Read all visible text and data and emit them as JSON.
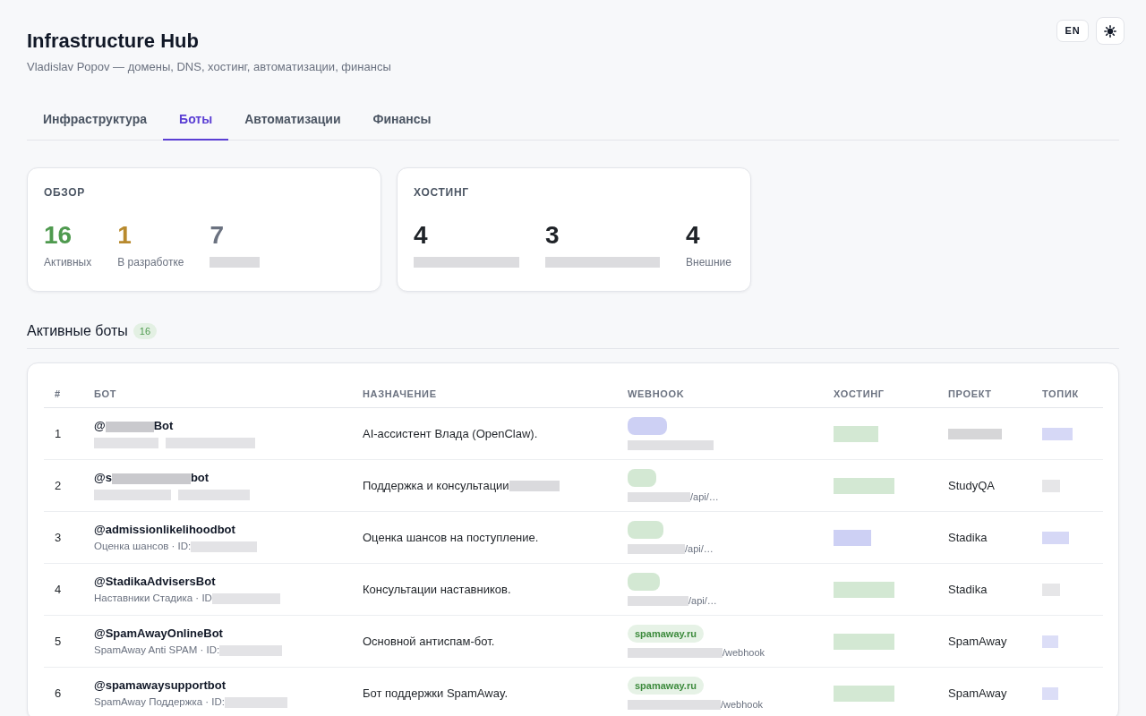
{
  "header": {
    "title": "Infrastructure Hub",
    "subtitle": "Vladislav Popov — домены, DNS, хостинг, автоматизации, финансы",
    "language_button": "EN"
  },
  "tabs": [
    {
      "label": "Инфраструктура",
      "selected": false
    },
    {
      "label": "Боты",
      "selected": true
    },
    {
      "label": "Автоматизации",
      "selected": false
    },
    {
      "label": "Финансы",
      "selected": false
    }
  ],
  "summary_cards": [
    {
      "title": "ОБЗОР",
      "stats": [
        {
          "value": "16",
          "color": "#4f9a4f",
          "label": [
            {
              "kind": "text",
              "text": "Активных"
            }
          ]
        },
        {
          "value": "1",
          "color": "#b88a2e",
          "label": [
            {
              "kind": "text",
              "text": "В разработке"
            }
          ]
        },
        {
          "value": "7",
          "color": "#6b7280",
          "label": [
            {
              "kind": "blur",
              "color": "#dcdcdf"
            }
          ]
        }
      ]
    },
    {
      "title": "ХОСТИНГ",
      "stats": [
        {
          "value": "4",
          "color": "#1f2328",
          "label": [
            {
              "kind": "blur",
              "color": "#dcdcdf"
            }
          ]
        },
        {
          "value": "3",
          "color": "#1f2328",
          "label": [
            {
              "kind": "blur",
              "color": "#dcdcdf"
            }
          ]
        },
        {
          "value": "4",
          "color": "#1f2328",
          "label": [
            {
              "kind": "text",
              "text": "Внешние"
            }
          ]
        }
      ]
    }
  ],
  "section": {
    "title": "Активные боты",
    "count": "16"
  },
  "table": {
    "columns": [
      "#",
      "БОТ",
      "НАЗНАЧЕНИЕ",
      "WEBHOOK",
      "ХОСТИНГ",
      "ПРОЕКТ",
      "ТОПИК"
    ],
    "rows": [
      {
        "number": "1",
        "handle": [
          {
            "kind": "text",
            "text": "@"
          },
          {
            "kind": "blur",
            "color": "#c9c9cd"
          },
          {
            "kind": "text",
            "text": "Bot"
          }
        ],
        "details": [
          {
            "kind": "blur",
            "color": "#e3e3e6"
          },
          {
            "kind": "blur",
            "color": "#e3e3e6"
          }
        ],
        "purpose": [
          {
            "kind": "text",
            "text": "AI-ассистент Влада (OpenClaw)."
          }
        ],
        "webhook_badge": [
          {
            "kind": "blur",
            "color": "#cdd0f4"
          }
        ],
        "webhook_url": [
          {
            "kind": "blur",
            "color": "#e0e0e3"
          }
        ],
        "hosting": [
          {
            "kind": "blur",
            "color": "#d3e8d3"
          }
        ],
        "project": [
          {
            "kind": "blur",
            "color": "#d6d6d8"
          }
        ],
        "topic": [
          {
            "kind": "blur",
            "color": "#d6d8f6"
          }
        ]
      },
      {
        "number": "2",
        "handle": [
          {
            "kind": "text",
            "text": "@s"
          },
          {
            "kind": "blur",
            "color": "#c9c9cd"
          },
          {
            "kind": "text",
            "text": "bot"
          }
        ],
        "details": [
          {
            "kind": "blur",
            "color": "#e3e3e6"
          },
          {
            "kind": "blur",
            "color": "#e3e3e6"
          }
        ],
        "purpose": [
          {
            "kind": "text",
            "text": "Поддержка и консультации"
          },
          {
            "kind": "blur",
            "color": "#dadadd"
          }
        ],
        "webhook_badge": [
          {
            "kind": "blur",
            "color": "#d3e8d3"
          }
        ],
        "webhook_url": [
          {
            "kind": "blur",
            "color": "#e0e0e3"
          },
          {
            "kind": "text",
            "text": "/api/…"
          }
        ],
        "hosting": [
          {
            "kind": "blur",
            "color": "#d3e8d3"
          }
        ],
        "project": [
          {
            "kind": "text",
            "text": "StudyQA"
          }
        ],
        "topic": [
          {
            "kind": "blur",
            "color": "#e6e6e8"
          }
        ]
      },
      {
        "number": "3",
        "handle": [
          {
            "kind": "text",
            "text": "@admissionlikelihoodbot"
          }
        ],
        "details": [
          {
            "kind": "text",
            "text": "Оценка шансов · ID:"
          },
          {
            "kind": "blur",
            "color": "#e3e3e6"
          }
        ],
        "purpose": [
          {
            "kind": "text",
            "text": "Оценка шансов на поступление."
          }
        ],
        "webhook_badge": [
          {
            "kind": "blur",
            "color": "#d3e8d3"
          }
        ],
        "webhook_url": [
          {
            "kind": "blur",
            "color": "#e0e0e3"
          },
          {
            "kind": "text",
            "text": "/api/…"
          }
        ],
        "hosting": [
          {
            "kind": "blur",
            "color": "#cdd0f4"
          }
        ],
        "project": [
          {
            "kind": "text",
            "text": "Stadika"
          }
        ],
        "topic": [
          {
            "kind": "blur",
            "color": "#d6d8f6"
          }
        ]
      },
      {
        "number": "4",
        "handle": [
          {
            "kind": "text",
            "text": "@StadikaAdvisersBot"
          }
        ],
        "details": [
          {
            "kind": "text",
            "text": "Наставники Стадика · ID"
          },
          {
            "kind": "blur",
            "color": "#e3e3e6"
          }
        ],
        "purpose": [
          {
            "kind": "text",
            "text": "Консультации наставников."
          }
        ],
        "webhook_badge": [
          {
            "kind": "blur",
            "color": "#d3e8d3"
          }
        ],
        "webhook_url": [
          {
            "kind": "blur",
            "color": "#e0e0e3"
          },
          {
            "kind": "text",
            "text": "/api/…"
          }
        ],
        "hosting": [
          {
            "kind": "blur",
            "color": "#d3e8d3"
          }
        ],
        "project": [
          {
            "kind": "text",
            "text": "Stadika"
          }
        ],
        "topic": [
          {
            "kind": "blur",
            "color": "#e6e6e8"
          }
        ]
      },
      {
        "number": "5",
        "handle": [
          {
            "kind": "text",
            "text": "@SpamAwayOnlineBot"
          }
        ],
        "details": [
          {
            "kind": "text",
            "text": "SpamAway Anti SPAM · ID:"
          },
          {
            "kind": "blur",
            "color": "#e3e3e6"
          }
        ],
        "purpose": [
          {
            "kind": "text",
            "text": "Основной антиспам-бот."
          }
        ],
        "webhook_badge": [
          {
            "kind": "text",
            "text": "spamaway.ru"
          }
        ],
        "webhook_url": [
          {
            "kind": "blur",
            "color": "#e0e0e3"
          },
          {
            "kind": "text",
            "text": "/webhook"
          }
        ],
        "hosting": [
          {
            "kind": "blur",
            "color": "#d3e8d3"
          }
        ],
        "project": [
          {
            "kind": "text",
            "text": "SpamAway"
          }
        ],
        "topic": [
          {
            "kind": "blur",
            "color": "#dcdef7"
          }
        ]
      },
      {
        "number": "6",
        "handle": [
          {
            "kind": "text",
            "text": "@spamawaysupportbot"
          }
        ],
        "details": [
          {
            "kind": "text",
            "text": "SpamAway Поддержка · ID:"
          },
          {
            "kind": "blur",
            "color": "#e3e3e6"
          }
        ],
        "purpose": [
          {
            "kind": "text",
            "text": "Бот поддержки SpamAway."
          }
        ],
        "webhook_badge": [
          {
            "kind": "text",
            "text": "spamaway.ru"
          }
        ],
        "webhook_url": [
          {
            "kind": "blur",
            "color": "#e0e0e3"
          },
          {
            "kind": "text",
            "text": "/webhook"
          }
        ],
        "hosting": [
          {
            "kind": "blur",
            "color": "#d3e8d3"
          }
        ],
        "project": [
          {
            "kind": "text",
            "text": "SpamAway"
          }
        ],
        "topic": [
          {
            "kind": "blur",
            "color": "#dcdef7"
          }
        ]
      }
    ]
  }
}
